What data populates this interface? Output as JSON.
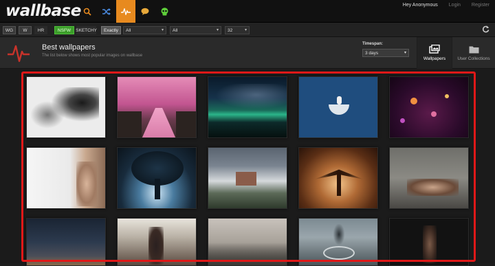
{
  "topbar": {
    "logo": "wallbase",
    "user_name": "Hey Anonymous",
    "login_label": "Login",
    "register_label": "Register",
    "nav_icons": [
      "search-icon",
      "random-shuffle-icon",
      "activity-pulse-icon",
      "chat-bubble-icon",
      "skull-icon"
    ],
    "active_icon": "activity-pulse-icon",
    "accent": "#e78a1f"
  },
  "filters": {
    "buttons": [
      "WG",
      "W",
      "HR",
      "NSFW",
      "SKETCHY",
      "Exactly"
    ],
    "nsfw_color": "#3c9d2a",
    "selects": [
      "All",
      "All",
      "32"
    ],
    "refresh_icon": "refresh-icon"
  },
  "header": {
    "title": "Best wallpapers",
    "subtitle": "The list below shows most popular images on wallbase",
    "timespan_label": "Timespan:",
    "timespan_value": "3 days",
    "tabs": [
      "Wallpapers",
      "User Collections"
    ]
  },
  "thumbnails": [
    "ink-splatter-bird",
    "pink-cherry-blossom-path",
    "aurora-night-sky",
    "astronaut-on-moon",
    "purple-bokeh",
    "woman-portrait-white",
    "blue-glowing-tree",
    "mountain-village-fog",
    "winged-figure-sunset",
    "woman-lying-room",
    "night-sky-horizon",
    "woman-sitting-interior",
    "misty-forest",
    "foggy-tree-road",
    "fantasy-warrior-dark"
  ],
  "highlight_color": "#e01818"
}
